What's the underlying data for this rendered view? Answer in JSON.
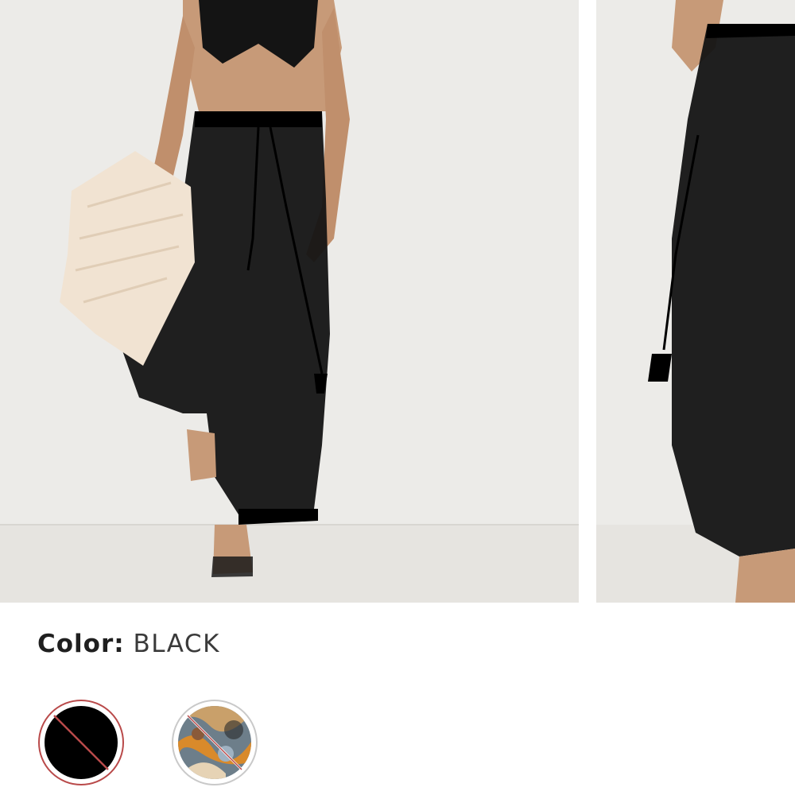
{
  "gallery": {
    "images": [
      {
        "alt": "black-sheer-pants-front-image"
      },
      {
        "alt": "black-sheer-pants-side-image"
      }
    ]
  },
  "color": {
    "label": "Color:",
    "value": "BLACK"
  },
  "swatches": [
    {
      "name": "black",
      "fill": "#000000",
      "selected": true,
      "unavailable": true
    },
    {
      "name": "print",
      "fill": "#d98a2b",
      "selected": false,
      "unavailable": true
    }
  ],
  "colors": {
    "unavailable_slash": "#b94a4a",
    "background": "#ffffff"
  }
}
